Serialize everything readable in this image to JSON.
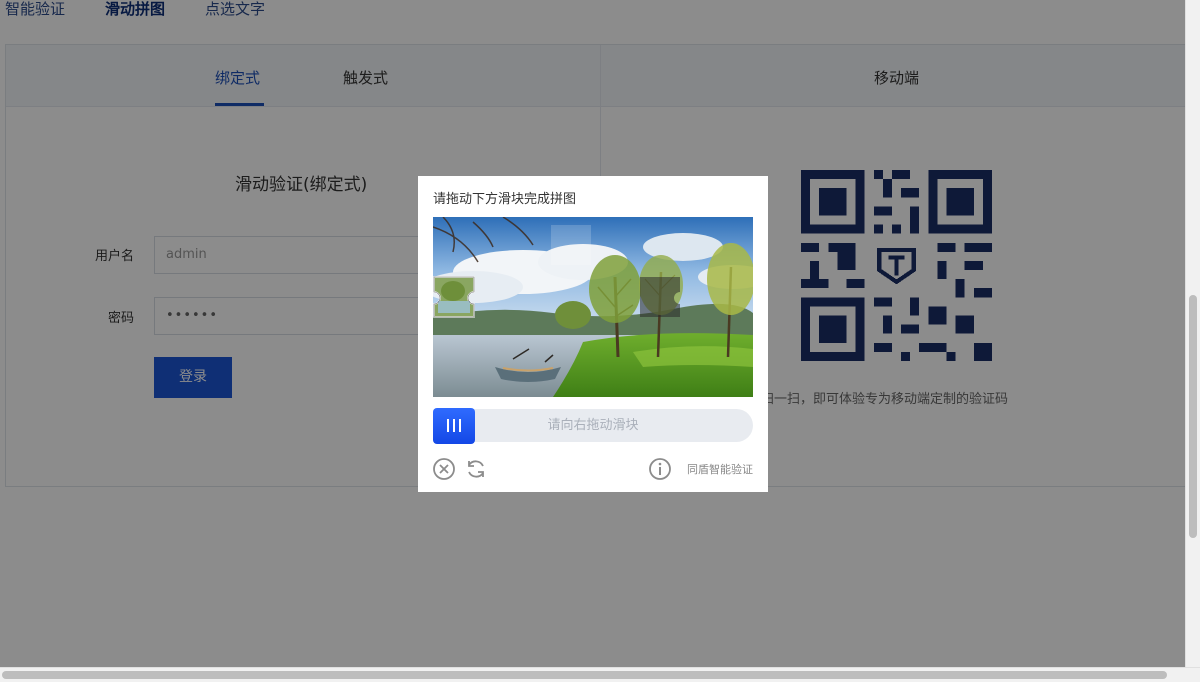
{
  "top_nav": {
    "items": [
      "智能验证",
      "滑动拼图",
      "点选文字"
    ],
    "active": "滑动拼图"
  },
  "panel": {
    "tabs": [
      "绑定式",
      "触发式"
    ],
    "active_tab": "绑定式",
    "mobile_title": "移动端",
    "form_title": "滑动验证(绑定式)",
    "username_label": "用户名",
    "username_placeholder": "admin",
    "password_label": "密码",
    "password_value": "••••••",
    "login_label": "登录",
    "qr_caption": "扫一扫，即可体验专为移动端定制的验证码"
  },
  "captcha": {
    "title": "请拖动下方滑块完成拼图",
    "slider_hint": "请向右拖动滑块",
    "slider_progress": 0,
    "close_icon": "close-circle-icon",
    "refresh_icon": "refresh-icon",
    "info_icon": "info-icon",
    "brand": "同盾智能验证"
  },
  "colors": {
    "accent": "#1c56d6",
    "active_nav": "#0d2f79",
    "overlay": "rgba(0,0,0,0.45)"
  }
}
